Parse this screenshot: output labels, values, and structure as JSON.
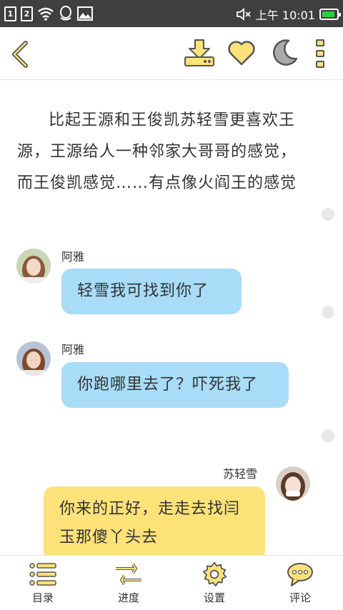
{
  "status_bar": {
    "sim1": "1",
    "sim2": "2",
    "time": "上午 10:01",
    "icons": [
      "sim1-icon",
      "sim2-icon",
      "wifi-icon",
      "qq-icon",
      "image-icon",
      "mute-icon",
      "battery-icon"
    ]
  },
  "toolbar": {
    "icons": [
      "back-icon",
      "download-icon",
      "favorite-heart-icon",
      "night-mode-moon-icon",
      "more-icon"
    ],
    "accent_color": "#fde27a",
    "stroke_color": "#555555"
  },
  "story": {
    "narration": "比起王源和王俊凯苏轻雪更喜欢王源，王源给人一种邻家大哥哥的感觉，而王俊凯感觉……有点像火阎王的感觉",
    "messages": [
      {
        "speaker": "阿雅",
        "text": "轻雪我可找到你了",
        "side": "left",
        "color": "#a8dcf7"
      },
      {
        "speaker": "阿雅",
        "text": "你跑哪里去了？吓死我了",
        "side": "left",
        "color": "#a8dcf7"
      },
      {
        "speaker": "苏轻雪",
        "text": "你来的正好，走走去找闫玉那傻丫头去",
        "side": "right",
        "color": "#fde27a"
      }
    ]
  },
  "bottom_nav": {
    "items": [
      {
        "label": "目录",
        "icon": "catalog-list-icon"
      },
      {
        "label": "进度",
        "icon": "progress-arrows-icon"
      },
      {
        "label": "设置",
        "icon": "settings-gear-icon"
      },
      {
        "label": "评论",
        "icon": "comment-bubble-icon"
      }
    ]
  }
}
